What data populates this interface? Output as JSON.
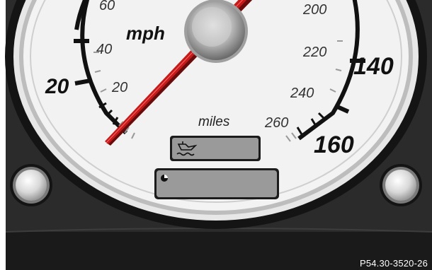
{
  "gauge": {
    "unit_mph": "mph",
    "unit_miles": "miles",
    "outer_scale_labels": [
      "20",
      "140",
      "160"
    ],
    "inner_scale_labels": [
      "60",
      "40",
      "20",
      "200",
      "220",
      "240",
      "260"
    ]
  },
  "displays": {
    "oil_level_icon": "oil-can-icon",
    "clock_icon": "clock-icon"
  },
  "colors": {
    "needle": "#b01515",
    "dial_face": "#f2f2f2",
    "panel": "#2a2a2a",
    "display_lcd": "#9a9a9a"
  },
  "caption": "P54.30-3520-26"
}
